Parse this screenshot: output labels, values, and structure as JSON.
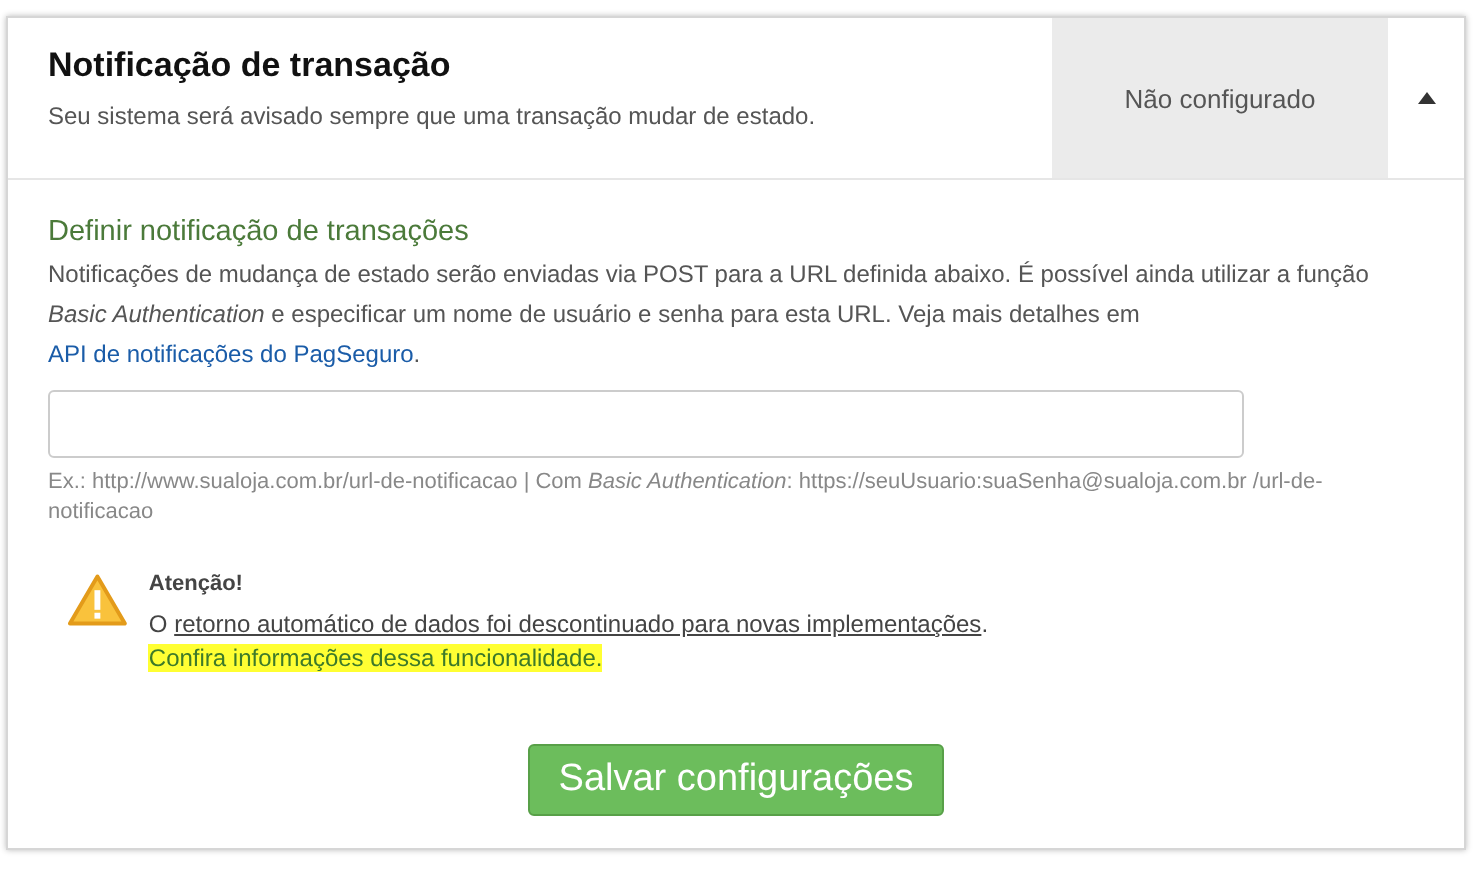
{
  "header": {
    "title": "Notificação de transação",
    "subtitle": "Seu sistema será avisado sempre que uma transação mudar de estado.",
    "status": "Não configurado",
    "expanded": true
  },
  "section": {
    "heading": "Definir notificação de transações",
    "description": "Notificações de mudança de estado serão enviadas via POST para a URL definida abaixo. É possível ainda utilizar a função *Basic Authentication* e especificar um nome de usuário e senha para esta URL. Veja mais detalhes em",
    "link": "API de notificações do PagSeguro",
    "link_end": ".",
    "hint": "Ex.: http://www.sualoja.com.br/url-de-notificacao | Com *Basic Authentication*: https://seuUsuario:suaSenha@sualoja.com.br /url-de-notificacao"
  },
  "alert": {
    "title": "Atenção!",
    "prefix": "O",
    "link": "retorno automático de dados foi descontinuado para novas implementações",
    "separator": ".",
    "highlight_link": "Confira informações dessa funcionalidade.",
    "highlighted": true
  },
  "button": "Salvar configurações"
}
